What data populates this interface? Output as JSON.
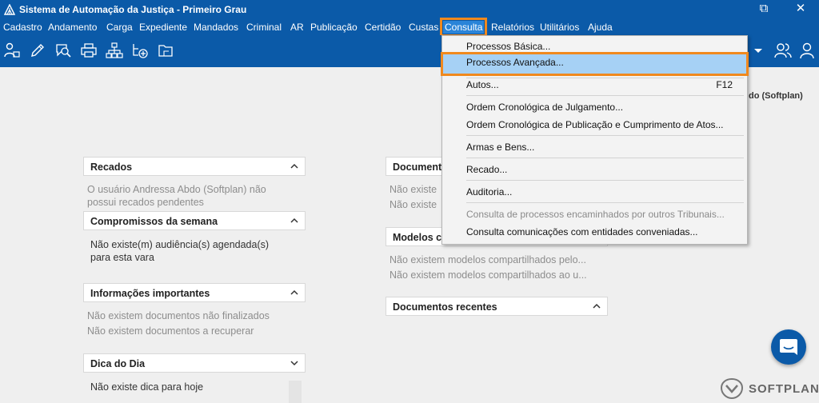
{
  "window": {
    "title": "Sistema de Automação da Justiça - Primeiro Grau",
    "restore_glyph": "⧉",
    "close_glyph": "✕"
  },
  "menubar": {
    "items": [
      "Cadastro",
      "Andamento",
      "Carga",
      "Expediente",
      "Mandados",
      "Criminal",
      "AR",
      "Publicação",
      "Certidão",
      "Custas",
      "Consulta",
      "Relatórios",
      "Utilitários",
      "Ajuda"
    ],
    "active": "Consulta"
  },
  "toolbar": {
    "icons": [
      "user-key-icon",
      "edit-icon",
      "search-chat-icon",
      "printer-icon",
      "hierarchy-icon",
      "add-tree-icon",
      "folder-icon"
    ],
    "right_icons": [
      "dropdown-arrow-icon",
      "users-icon",
      "user-icon"
    ]
  },
  "dropdown": {
    "items": [
      {
        "label": "Processos Básica...",
        "disabled": false
      },
      {
        "label": "Processos Avançada...",
        "disabled": false,
        "highlighted": true
      },
      {
        "label": "Autos...",
        "shortcut": "F12",
        "disabled": false
      },
      {
        "label": "Ordem Cronológica de Julgamento...",
        "disabled": false
      },
      {
        "label": "Ordem Cronológica de Publicação e Cumprimento de Atos...",
        "disabled": false
      },
      {
        "label": "Armas e Bens...",
        "disabled": false
      },
      {
        "label": "Recado...",
        "disabled": false
      },
      {
        "label": "Auditoria...",
        "disabled": false
      },
      {
        "label": "Consulta de processos encaminhados por outros Tribunais...",
        "disabled": true
      },
      {
        "label": "Consulta comunicações com entidades conveniadas...",
        "disabled": false
      }
    ]
  },
  "user_corner": "do (Softplan)",
  "panels": {
    "recados": {
      "title": "Recados",
      "lines": [
        "O usuário Andressa Abdo (Softplan) não",
        "possui recados pendentes"
      ]
    },
    "compromissos": {
      "title": "Compromissos da semana",
      "lines": [
        "Não existe(m) audiência(s) agendada(s)",
        "para esta vara"
      ]
    },
    "informacoes": {
      "title": "Informações importantes",
      "lines": [
        "Não existem documentos não finalizados",
        "Não existem documentos a recuperar"
      ]
    },
    "dica": {
      "title": "Dica do Dia",
      "lines": [
        "Não existe dica para hoje"
      ]
    },
    "documentos": {
      "title": "Document",
      "lines": [
        "Não existe",
        "Não existe"
      ]
    },
    "modelos": {
      "title": "Modelos c",
      "lines": [
        "Não existem modelos compartilhados pelo...",
        "Não existem modelos compartilhados ao u..."
      ]
    },
    "recentes": {
      "title": "Documentos recentes"
    }
  },
  "brand": {
    "name": "SOFTPLAN"
  },
  "colors": {
    "primary": "#0b5aa8",
    "highlight": "#a6d1f5",
    "annotation": "#f0891e"
  }
}
